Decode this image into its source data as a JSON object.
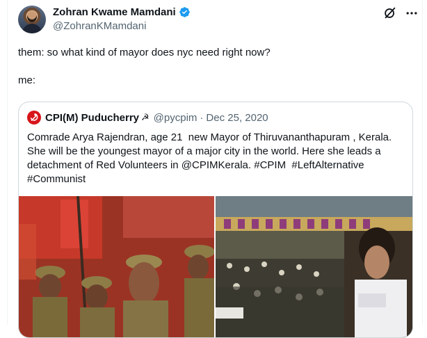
{
  "author": {
    "display_name": "Zohran Kwame Mamdani",
    "handle": "@ZohranKMamdani",
    "verified": true
  },
  "icons": [
    "verified-badge-icon",
    "grok-icon",
    "more-icon",
    "hammer-sickle-icon"
  ],
  "tweet": {
    "line1": "them: so what kind of mayor does nyc need right now?",
    "line2": "me:"
  },
  "quote": {
    "name": "CPI(M) Puducherry",
    "name_emoji": "☭",
    "handle": "@pycpim",
    "separator": "·",
    "date": "Dec 25, 2020",
    "text_lines": [
      "Comrade Arya Rajendran, age 21  new Mayor of Thiruvananthapuram , Kerala.",
      "She will be the youngest mayor of a major city in the world. Here she leads a",
      "detachment of Red Volunteers in @CPIMKerala. #CPIM  #LeftAlternative",
      "#Communist"
    ]
  },
  "colors": {
    "text_primary": "#0f1419",
    "text_secondary": "#536471",
    "verified_blue": "#1d9bf0",
    "border": "#cfd9de",
    "cpim_red": "#d7151b"
  }
}
